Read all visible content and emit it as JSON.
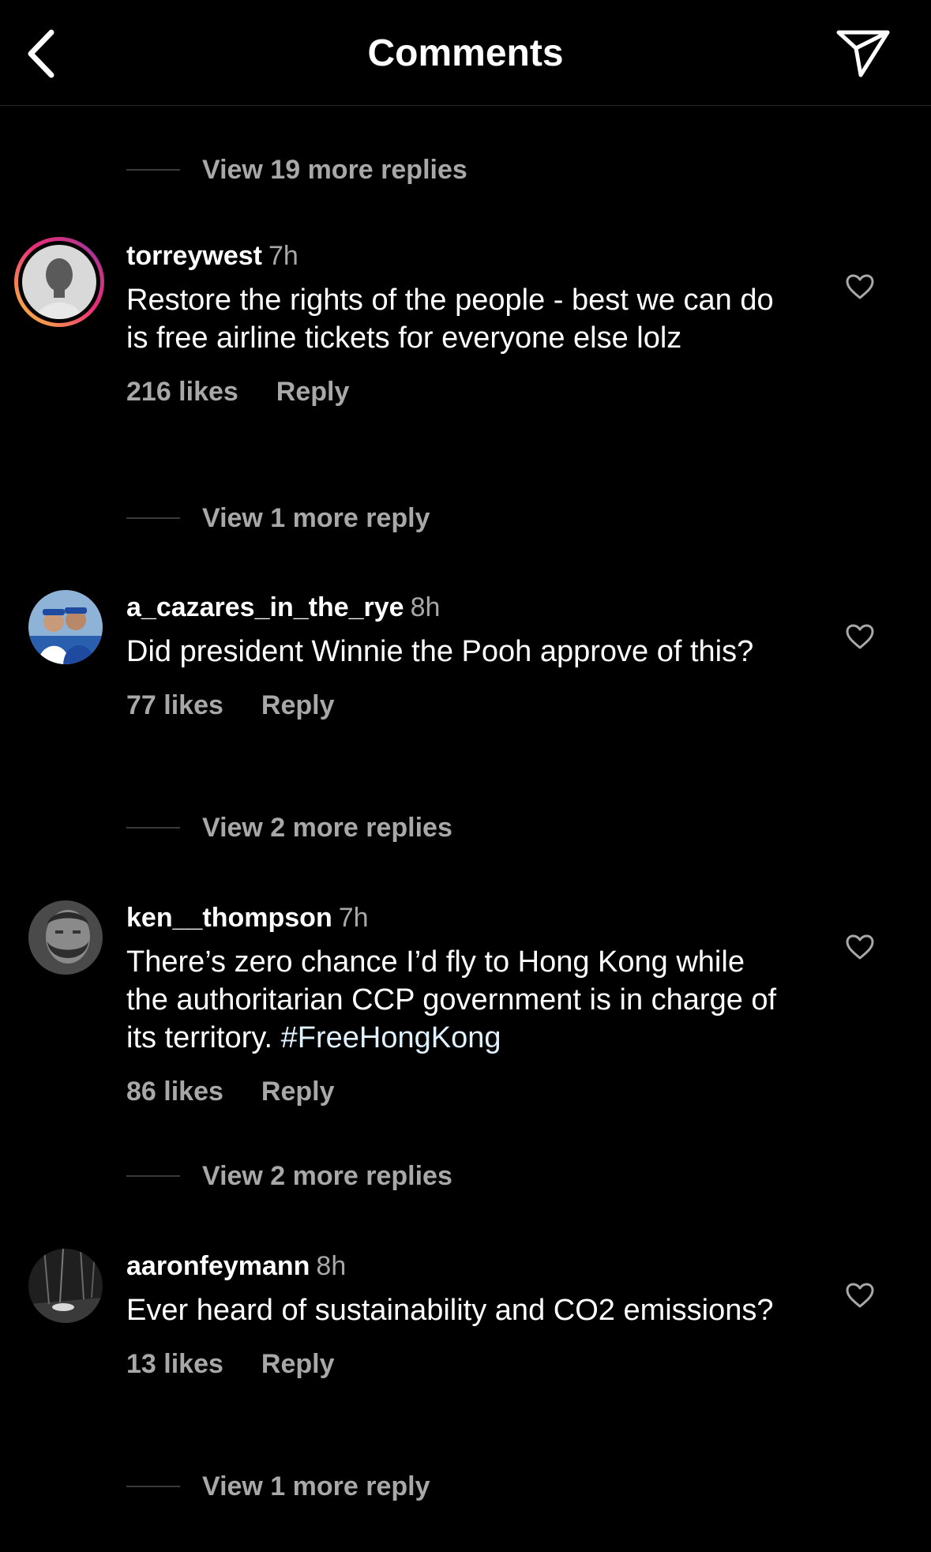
{
  "header": {
    "title": "Comments",
    "back_icon": "chevron-left-icon",
    "share_icon": "paper-plane-icon"
  },
  "threads": [
    {
      "view_replies": "View 19 more replies"
    },
    {
      "comment": {
        "username": "torreywest",
        "time": "7h",
        "text": "Restore the rights of the people - best we can do is free airline tickets for everyone else lolz",
        "likes": "216 likes",
        "reply": "Reply",
        "has_story": true
      },
      "view_replies": "View 1 more reply"
    },
    {
      "comment": {
        "username": "a_cazares_in_the_rye",
        "time": "8h",
        "text": "Did president Winnie the Pooh approve of this?",
        "likes": "77 likes",
        "reply": "Reply"
      },
      "view_replies": "View 2 more replies"
    },
    {
      "comment": {
        "username": "ken__thompson",
        "time": "7h",
        "text": "There’s zero chance I’d fly to Hong Kong while the authoritarian CCP government is in charge of its territory. ",
        "hashtag": "#FreeHongKong",
        "likes": "86 likes",
        "reply": "Reply"
      },
      "view_replies": "View 2 more replies"
    },
    {
      "comment": {
        "username": "aaronfeymann",
        "time": "8h",
        "text": "Ever heard of sustainability and CO2 emissions?",
        "likes": "13 likes",
        "reply": "Reply"
      },
      "view_replies": "View 1 more reply"
    }
  ],
  "colors": {
    "background": "#000000",
    "secondary_text": "#a8a8a8",
    "hashtag": "#e0f1ff",
    "story_ring": "#ee2a7b"
  }
}
